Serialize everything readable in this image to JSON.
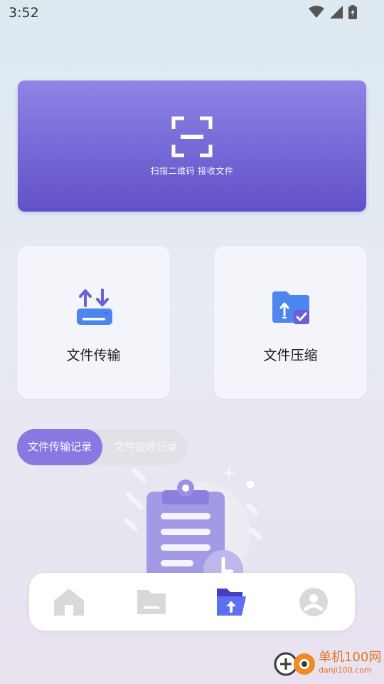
{
  "status_bar": {
    "time": "3:52",
    "icons": [
      "wifi-icon",
      "signal-icon",
      "battery-charging-icon"
    ]
  },
  "scan_card": {
    "label": "扫描二维码 接收文件",
    "icon": "scan-frame-icon",
    "gradient_top": "#8e85e6",
    "gradient_bottom": "#6250c8"
  },
  "tiles": [
    {
      "label": "文件传输",
      "icon": "upload-download-tray-icon"
    },
    {
      "label": "文件压缩",
      "icon": "folder-upload-check-icon"
    }
  ],
  "record_tabs": {
    "active": "文件传输记录",
    "inactive": "文件接收记录",
    "accent": "#8878e2"
  },
  "empty_state": {
    "icon": "clipboard-clock-illustration"
  },
  "bottom_nav": [
    {
      "name": "home",
      "icon": "home-icon",
      "active": false
    },
    {
      "name": "files",
      "icon": "folder-icon",
      "active": false
    },
    {
      "name": "transfer",
      "icon": "folder-upload-icon",
      "active": true
    },
    {
      "name": "profile",
      "icon": "user-icon",
      "active": false
    }
  ],
  "watermark": {
    "title": "单机100网",
    "url": "danji100.com"
  }
}
